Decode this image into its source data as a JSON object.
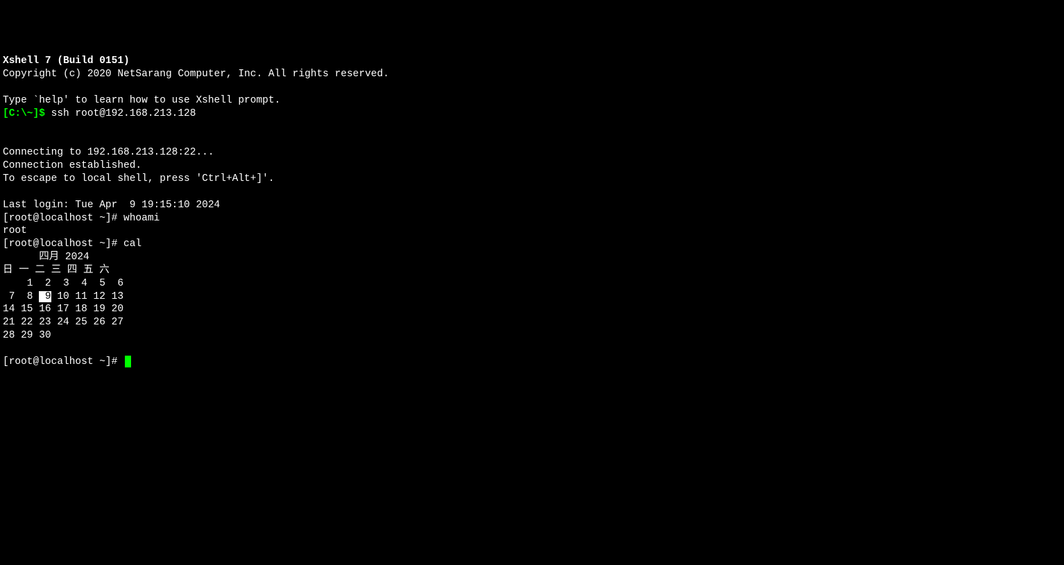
{
  "header": {
    "title": "Xshell 7 (Build 0151)",
    "copyright": "Copyright (c) 2020 NetSarang Computer, Inc. All rights reserved."
  },
  "help_line": "Type `help' to learn how to use Xshell prompt.",
  "local_prompt": "[C:\\~]$ ",
  "ssh_command": "ssh root@192.168.213.128",
  "connection": {
    "connecting": "Connecting to 192.168.213.128:22...",
    "established": "Connection established.",
    "escape": "To escape to local shell, press 'Ctrl+Alt+]'."
  },
  "last_login": "Last login: Tue Apr  9 19:15:10 2024",
  "remote_prompt": "[root@localhost ~]# ",
  "cmd_whoami": "whoami",
  "whoami_output": "root",
  "cmd_cal": "cal",
  "calendar": {
    "title": "      四月 2024     ",
    "header": "日 一 二 三 四 五 六",
    "rows": [
      [
        " ",
        " ",
        "1",
        "2",
        "3",
        "4",
        "5",
        "6"
      ],
      [
        "7",
        "8",
        "9",
        "10",
        "11",
        "12",
        "13"
      ],
      [
        "14",
        "15",
        "16",
        "17",
        "18",
        "19",
        "20"
      ],
      [
        "21",
        "22",
        "23",
        "24",
        "25",
        "26",
        "27"
      ],
      [
        "28",
        "29",
        "30",
        " ",
        " ",
        " ",
        " "
      ]
    ],
    "highlighted_day": "9",
    "row1": "    1  2  3  4  5  6",
    "row2_pre": " 7  8 ",
    "row2_hl_pre": " ",
    "row2_hl": "9",
    "row2_post": " 10 11 12 13",
    "row3": "14 15 16 17 18 19 20",
    "row4": "21 22 23 24 25 26 27",
    "row5": "28 29 30"
  }
}
